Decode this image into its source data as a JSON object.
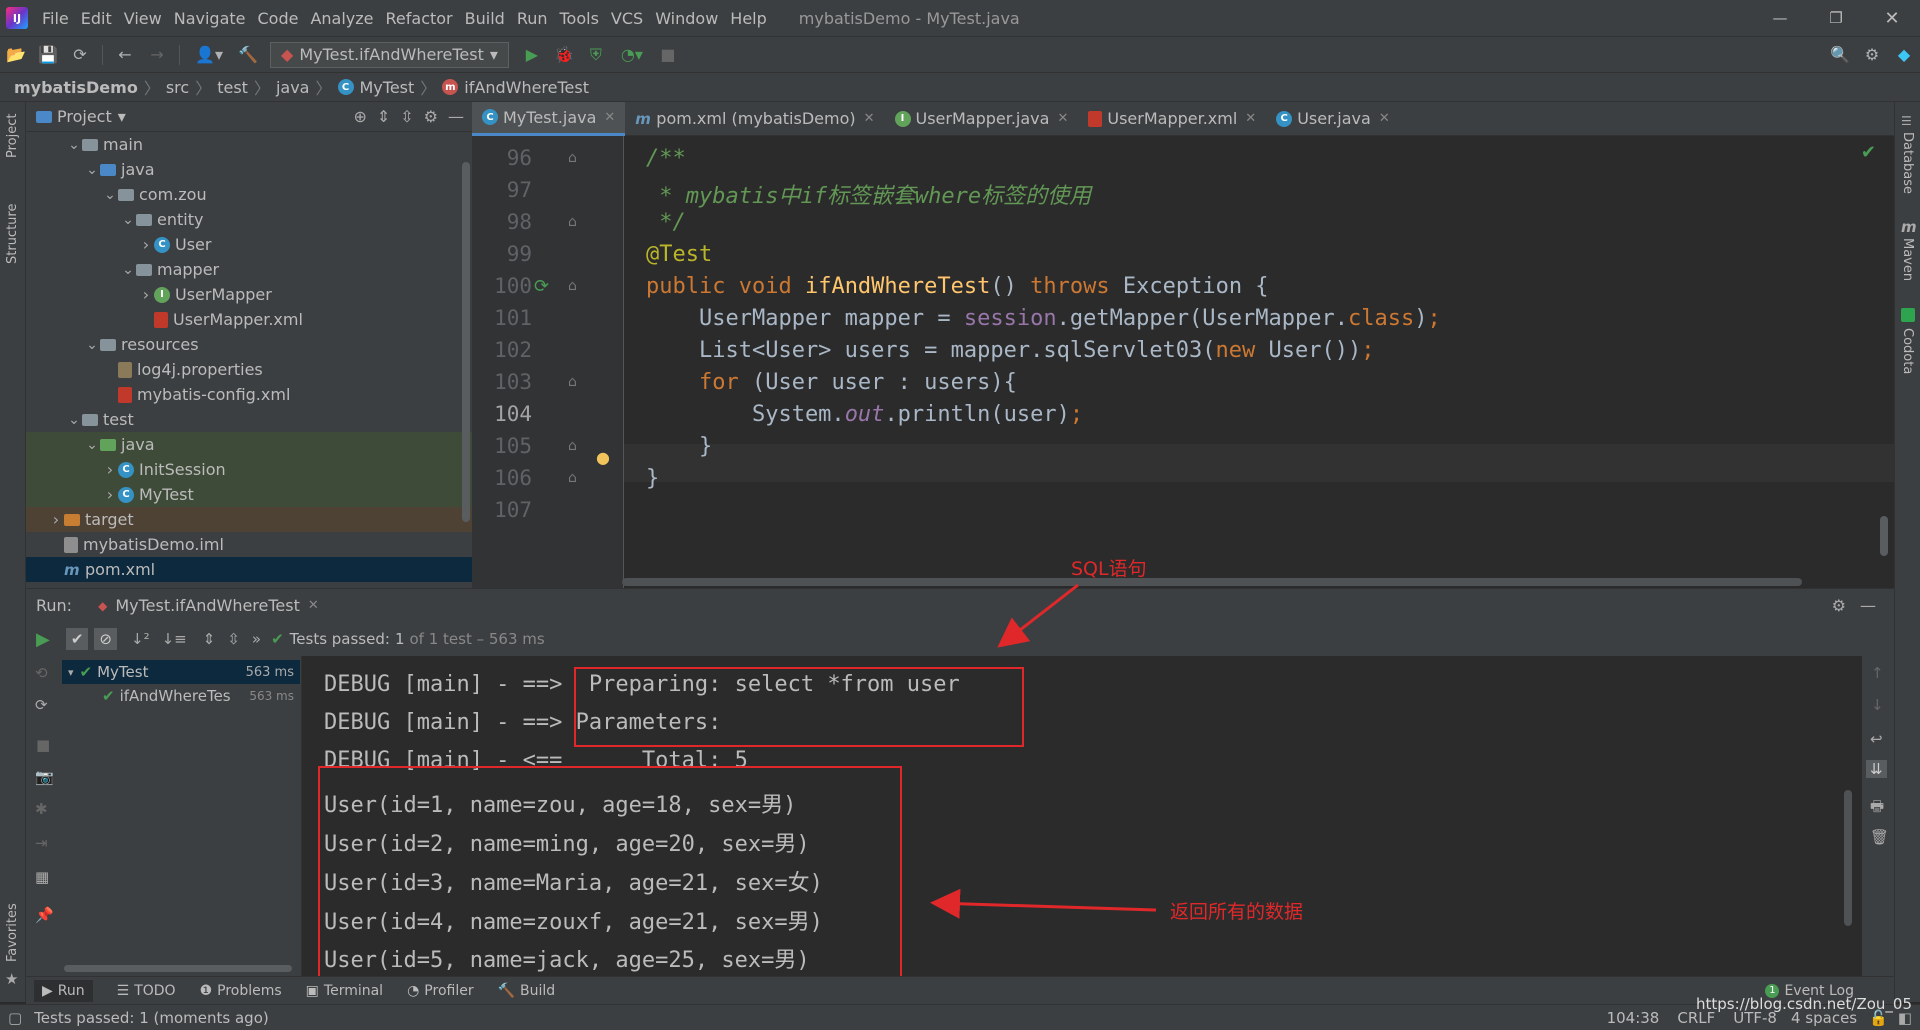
{
  "window": {
    "title": "mybatisDemo - MyTest.java"
  },
  "menu": [
    "File",
    "Edit",
    "View",
    "Navigate",
    "Code",
    "Analyze",
    "Refactor",
    "Build",
    "Run",
    "Tools",
    "VCS",
    "Window",
    "Help"
  ],
  "toolbar": {
    "run_config": "MyTest.ifAndWhereTest"
  },
  "breadcrumb": [
    "mybatisDemo",
    "src",
    "test",
    "java",
    "MyTest",
    "ifAndWhereTest"
  ],
  "project": {
    "header": "Project",
    "tree": [
      {
        "label": "main",
        "depth": 2,
        "type": "folder",
        "open": true
      },
      {
        "label": "java",
        "depth": 3,
        "type": "folder-blue",
        "open": true
      },
      {
        "label": "com.zou",
        "depth": 4,
        "type": "folder",
        "open": true
      },
      {
        "label": "entity",
        "depth": 5,
        "type": "folder",
        "open": true
      },
      {
        "label": "User",
        "depth": 6,
        "type": "class",
        "open": false
      },
      {
        "label": "mapper",
        "depth": 5,
        "type": "folder",
        "open": true
      },
      {
        "label": "UserMapper",
        "depth": 6,
        "type": "mapper",
        "open": false
      },
      {
        "label": "UserMapper.xml",
        "depth": 6,
        "type": "xml",
        "leaf": true
      },
      {
        "label": "resources",
        "depth": 3,
        "type": "folder",
        "open": true
      },
      {
        "label": "log4j.properties",
        "depth": 4,
        "type": "prop",
        "leaf": true
      },
      {
        "label": "mybatis-config.xml",
        "depth": 4,
        "type": "xml",
        "leaf": true
      },
      {
        "label": "test",
        "depth": 2,
        "type": "folder",
        "open": true
      },
      {
        "label": "java",
        "depth": 3,
        "type": "folder-green",
        "open": true
      },
      {
        "label": "InitSession",
        "depth": 4,
        "type": "class",
        "open": false
      },
      {
        "label": "MyTest",
        "depth": 4,
        "type": "class",
        "open": false
      },
      {
        "label": "target",
        "depth": 1,
        "type": "folder-orange",
        "open": false
      },
      {
        "label": "mybatisDemo.iml",
        "depth": 1,
        "type": "iml",
        "leaf": true
      },
      {
        "label": "pom.xml",
        "depth": 1,
        "type": "maven",
        "leaf": true
      }
    ]
  },
  "tabs": [
    {
      "label": "MyTest.java",
      "active": true
    },
    {
      "label": "pom.xml (mybatisDemo)",
      "active": false
    },
    {
      "label": "UserMapper.java",
      "active": false
    },
    {
      "label": "UserMapper.xml",
      "active": false
    },
    {
      "label": "User.java",
      "active": false
    }
  ],
  "editor": {
    "line_numbers": [
      "96",
      "97",
      "98",
      "99",
      "100",
      "101",
      "102",
      "103",
      "104",
      "105",
      "106",
      "107"
    ],
    "current_line": "104"
  },
  "run": {
    "label": "Run:",
    "config": "MyTest.ifAndWhereTest",
    "passed_text": "Tests passed:",
    "passed_count": "1",
    "passed_rest": "of 1 test – 563 ms",
    "tree": [
      {
        "label": "MyTest",
        "time": "563 ms"
      },
      {
        "label": "ifAndWhereTes",
        "time": "563 ms"
      }
    ],
    "console": [
      "DEBUG [main] - ==>  Preparing: select *from user",
      "DEBUG [main] - ==> Parameters: ",
      "DEBUG [main] - <==      Total: 5",
      "User(id=1, name=zou, age=18, sex=男)",
      "User(id=2, name=ming, age=20, sex=男)",
      "User(id=3, name=Maria, age=21, sex=女)",
      "User(id=4, name=zouxf, age=21, sex=男)",
      "User(id=5, name=jack, age=25, sex=男)"
    ]
  },
  "annotations": {
    "sql": "SQL语句",
    "data": "返回所有的数据"
  },
  "bottom_tabs": [
    "Run",
    "TODO",
    "Problems",
    "Terminal",
    "Profiler",
    "Build"
  ],
  "event_log": "Event Log",
  "status": {
    "message": "Tests passed: 1 (moments ago)",
    "position": "104:38",
    "line_sep": "CRLF",
    "encoding": "UTF-8",
    "indent": "4 spaces",
    "watermark": "https://blog.csdn.net/Zou_05"
  },
  "side": {
    "left": [
      "Project",
      "Structure",
      "Favorites"
    ],
    "right": [
      "Database",
      "Maven",
      "Codota"
    ]
  },
  "colors": {
    "bg": "#2b2b2b",
    "panel": "#3c3f41",
    "accent": "#4a88c7",
    "red": "#e0282b",
    "green": "#499c54"
  }
}
